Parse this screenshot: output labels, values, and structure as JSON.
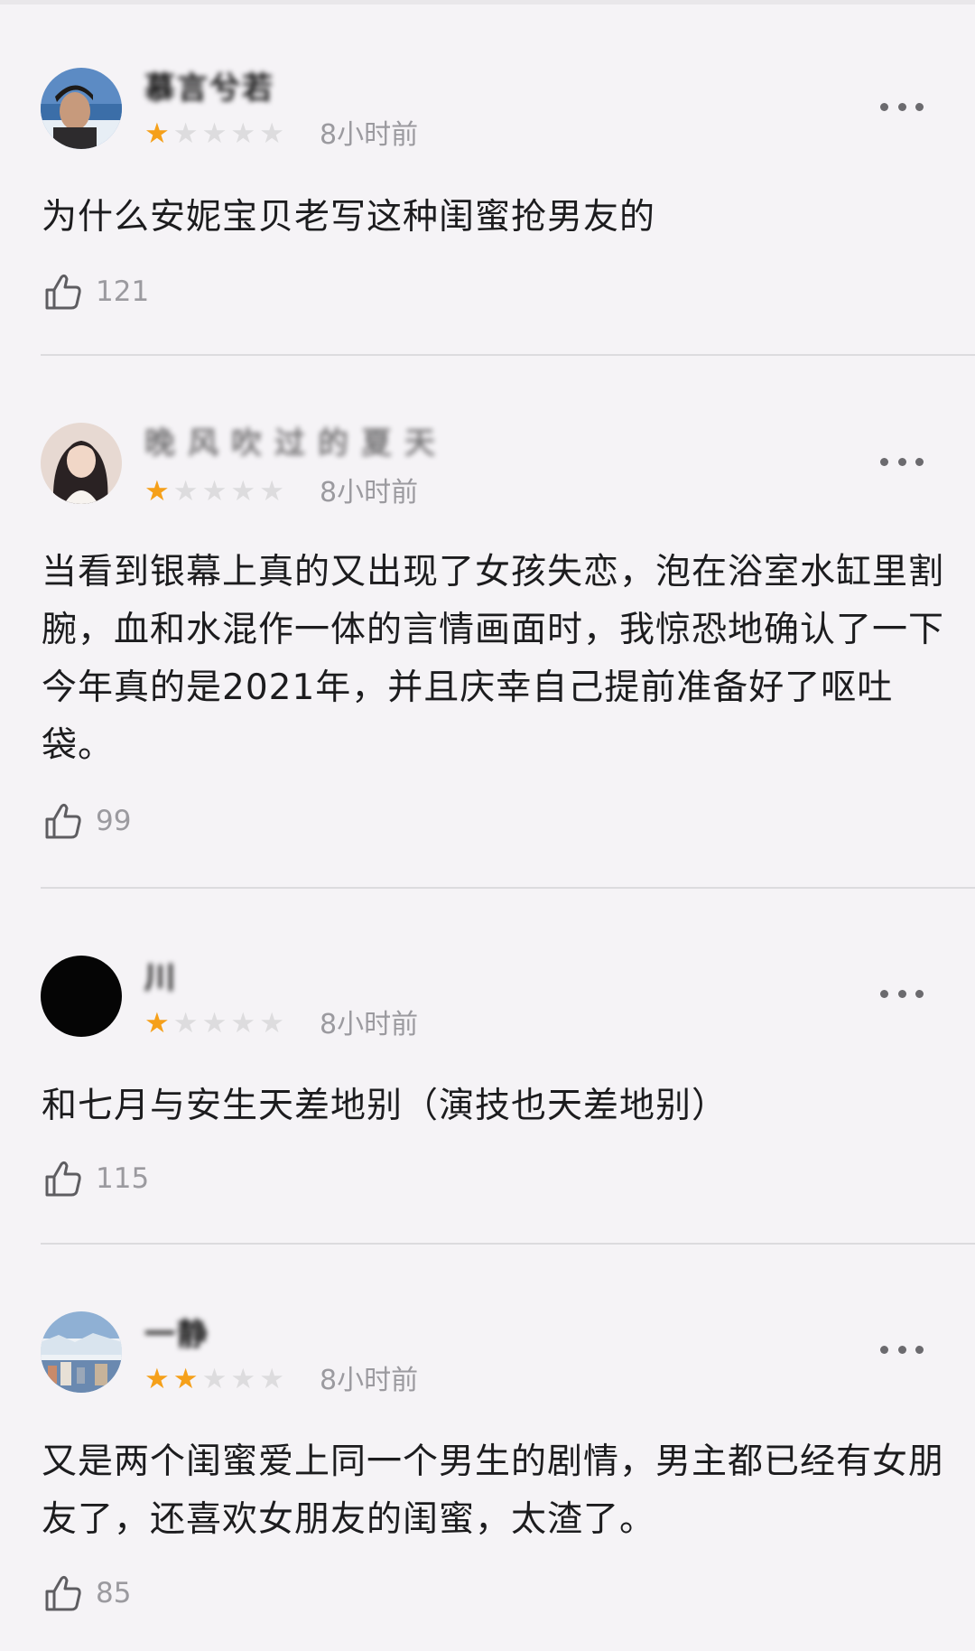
{
  "reviews": [
    {
      "username": "慕言兮若",
      "rating": 1,
      "time": "8小时前",
      "content": "为什么安妮宝贝老写这种闺蜜抢男友的",
      "likes": "121"
    },
    {
      "username": "晚风吹过的夏天",
      "rating": 1,
      "time": "8小时前",
      "content": "当看到银幕上真的又出现了女孩失恋，泡在浴室水缸里割腕，血和水混作一体的言情画面时，我惊恐地确认了一下今年真的是2021年，并且庆幸自己提前准备好了呕吐袋。",
      "likes": "99"
    },
    {
      "username": "川",
      "rating": 1,
      "time": "8小时前",
      "content": "和七月与安生天差地别（演技也天差地别）",
      "likes": "115"
    },
    {
      "username": "一静",
      "rating": 2,
      "time": "8小时前",
      "content": "又是两个闺蜜爱上同一个男生的剧情，男主都已经有女朋友了，还喜欢女朋友的闺蜜，太渣了。",
      "likes": "85"
    }
  ],
  "colors": {
    "background": "#f5f3f6",
    "star_on": "#f5a01a",
    "star_off": "#dddcde",
    "muted_text": "#9b9a9f"
  },
  "icons": {
    "more": "more-dots-icon",
    "like": "thumbs-up-icon",
    "star": "star-icon"
  }
}
